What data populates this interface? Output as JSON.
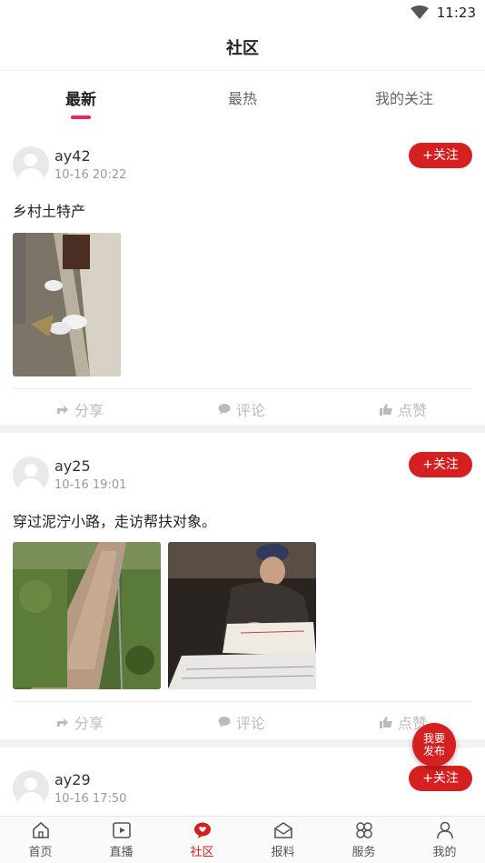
{
  "status": {
    "time": "11:23",
    "wifi_icon": "wifi-icon"
  },
  "header": {
    "title": "社区"
  },
  "tabs": [
    {
      "label": "最新",
      "active": true
    },
    {
      "label": "最热",
      "active": false
    },
    {
      "label": "我的关注",
      "active": false
    }
  ],
  "posts": [
    {
      "username": "ay42",
      "date": "10-16  20:22",
      "follow_label": "+关注",
      "text": "乡村土特产",
      "actions": {
        "share": "分享",
        "comment": "评论",
        "like": "点赞"
      }
    },
    {
      "username": "ay25",
      "date": "10-16  19:01",
      "follow_label": "+关注",
      "text": "穿过泥泞小路，走访帮扶对象。",
      "actions": {
        "share": "分享",
        "comment": "评论",
        "like": "点赞"
      }
    },
    {
      "username": "ay29",
      "date": "10-16  17:50",
      "follow_label": "+关注"
    }
  ],
  "fab": {
    "line1": "我要",
    "line2": "发布"
  },
  "nav": [
    {
      "label": "首页",
      "icon": "home-icon",
      "active": false
    },
    {
      "label": "直播",
      "icon": "video-icon",
      "active": false
    },
    {
      "label": "社区",
      "icon": "community-icon",
      "active": true
    },
    {
      "label": "报料",
      "icon": "report-icon",
      "active": false
    },
    {
      "label": "服务",
      "icon": "services-icon",
      "active": false
    },
    {
      "label": "我的",
      "icon": "profile-icon",
      "active": false
    }
  ],
  "colors": {
    "accent": "#d42020",
    "tab_indicator": "#e8265b"
  }
}
